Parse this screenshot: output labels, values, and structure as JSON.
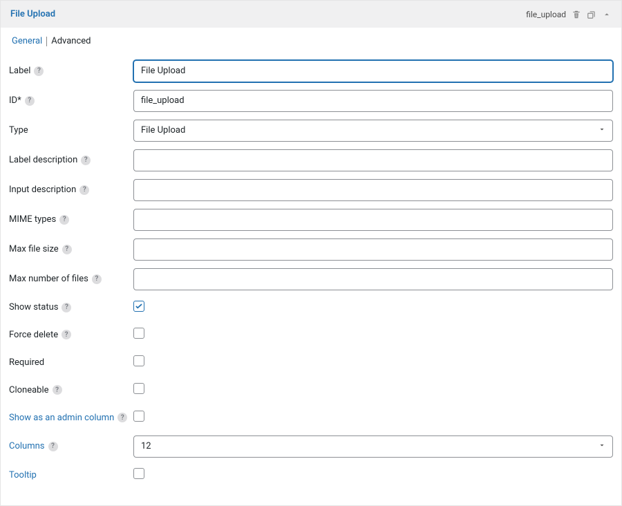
{
  "header": {
    "title": "File Upload",
    "slug": "file_upload"
  },
  "tabs": {
    "general": "General",
    "advanced": "Advanced"
  },
  "fields": {
    "label": {
      "label": "Label",
      "value": "File Upload"
    },
    "id": {
      "label": "ID*",
      "value": "file_upload"
    },
    "type": {
      "label": "Type",
      "value": "File Upload"
    },
    "label_description": {
      "label": "Label description",
      "value": ""
    },
    "input_description": {
      "label": "Input description",
      "value": ""
    },
    "mime_types": {
      "label": "MIME types",
      "value": ""
    },
    "max_file_size": {
      "label": "Max file size",
      "value": ""
    },
    "max_files": {
      "label": "Max number of files",
      "value": ""
    },
    "show_status": {
      "label": "Show status",
      "checked": true
    },
    "force_delete": {
      "label": "Force delete",
      "checked": false
    },
    "required": {
      "label": "Required",
      "checked": false
    },
    "cloneable": {
      "label": "Cloneable",
      "checked": false
    },
    "admin_column": {
      "label": "Show as an admin column",
      "checked": false
    },
    "columns": {
      "label": "Columns",
      "value": "12"
    },
    "tooltip": {
      "label": "Tooltip",
      "checked": false
    }
  }
}
